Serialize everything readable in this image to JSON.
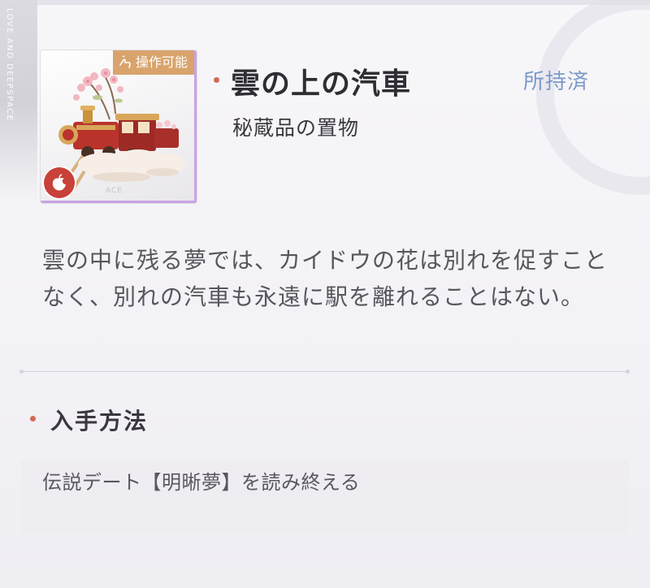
{
  "decor": {
    "side_text": "LOVE AND DEEPSPACE",
    "thumb_watermark": "ACE"
  },
  "item": {
    "title": "雲の上の汽車",
    "type": "秘蔵品の置物",
    "owned_status": "所持済",
    "badge_label": "操作可能",
    "badge_icon": "hand-tap-icon",
    "rarity_icon": "apple-bite-icon",
    "description": "雲の中に残る夢では、カイドウの花は別れを促すことなく、別れの汽車も永遠に駅を離れることはない。"
  },
  "acquisition": {
    "section_title": "入手方法",
    "source": "伝説デート【明晰夢】を読み終える"
  },
  "colors": {
    "accent_dot": "#d46a55",
    "owned_text": "#7b99c8",
    "badge_bg": "#d9a36c",
    "thumb_frame": "#c9a3e3",
    "rarity_bg": "#c8413a"
  }
}
